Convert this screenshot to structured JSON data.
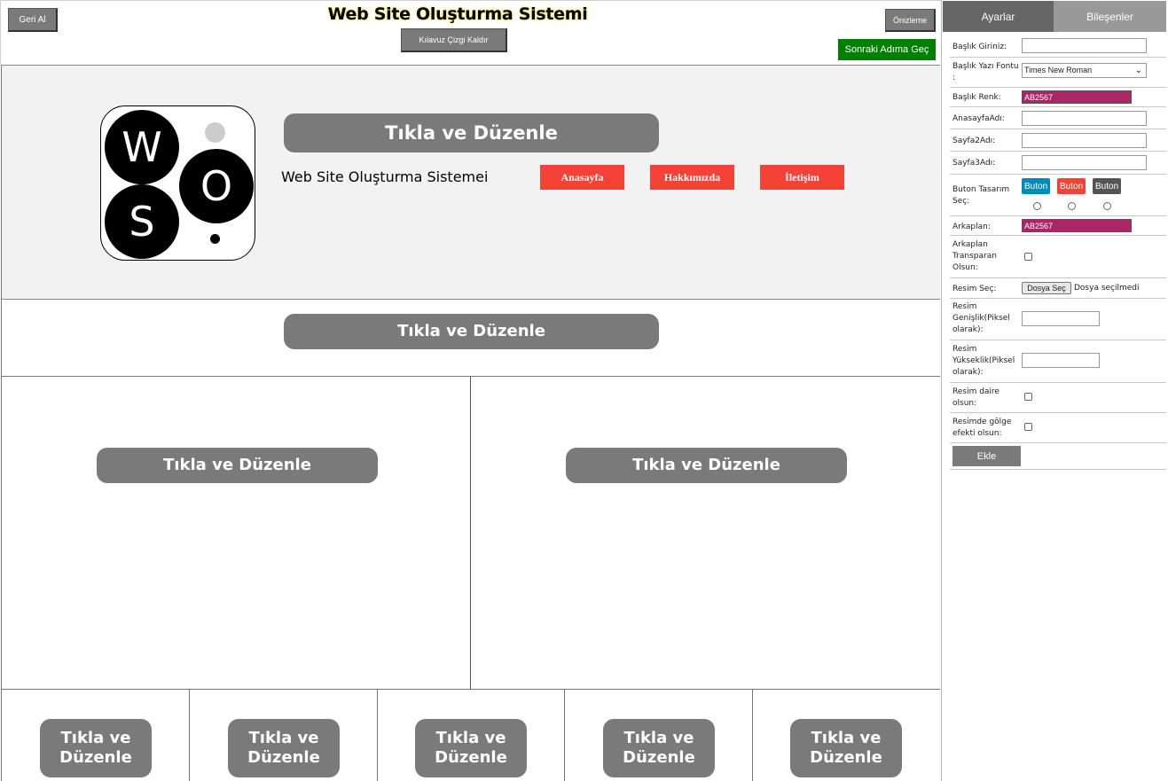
{
  "toolbar": {
    "undo_label": "Geri Al",
    "title": "Web Site Oluşturma Sistemi",
    "guides_label": "Kılavuz Çizgi Kaldır",
    "preview_label": "Önizleme",
    "next_label": "Sonraki Adıma Geç"
  },
  "canvas": {
    "logo_letters": [
      "W",
      "O",
      "S"
    ],
    "header_edit_label": "Tıkla ve Düzenle",
    "site_name": "Web Site Oluşturma Sistemei",
    "nav": [
      "Anasayfa",
      "Hakkımızda",
      "İletişim"
    ],
    "title_edit_label": "Tıkla ve Düzenle",
    "two_col_labels": [
      "Tıkla ve Düzenle",
      "Tıkla ve Düzenle"
    ],
    "five_col_labels": [
      "Tıkla ve\nDüzenle",
      "Tıkla ve\nDüzenle",
      "Tıkla ve\nDüzenle",
      "Tıkla ve\nDüzenle",
      "Tıkla ve\nDüzenle"
    ],
    "colors": {
      "header_bg": "#f2f2f2",
      "edit_btn": "#7a7a7a",
      "nav_btn": "#f44336"
    }
  },
  "panel": {
    "tabs": [
      "Ayarlar",
      "Bileşenler"
    ],
    "fields": {
      "title_input": {
        "label": "Başlık Giriniz:",
        "value": ""
      },
      "title_font": {
        "label": "Başlık Yazı Fontu :",
        "value": "Times New Roman"
      },
      "title_color": {
        "label": "Başlık Renk:",
        "value": "AB2567"
      },
      "home_name": {
        "label": "AnasayfaAdı:",
        "value": ""
      },
      "page2_name": {
        "label": "Sayfa2Adı:",
        "value": ""
      },
      "page3_name": {
        "label": "Sayfa3Adı:",
        "value": ""
      },
      "button_design": {
        "label": "Buton Tasarım Seç:",
        "options": [
          "Buton",
          "Buton",
          "Buton"
        ],
        "colors": [
          "#008cba",
          "#f44336",
          "#555555"
        ]
      },
      "background": {
        "label": "Arkaplan:",
        "value": "AB2567"
      },
      "bg_transparent": {
        "label": "Arkaplan Transparan Olsun:",
        "checked": false
      },
      "image_pick": {
        "label": "Resim Seç:",
        "button": "Dosya Seç",
        "status": "Dosya seçilmedi"
      },
      "image_width": {
        "label": "Resim Genişlik(Piksel olarak):",
        "value": ""
      },
      "image_height": {
        "label": "Resim Yükseklik(Piksel olarak):",
        "value": ""
      },
      "image_round": {
        "label": "Resim daire olsun:",
        "checked": false
      },
      "image_shadow": {
        "label": "Resimde gölge efekti olsun:",
        "checked": false
      }
    },
    "add_label": "Ekle",
    "accent_color": "#ab2567"
  }
}
